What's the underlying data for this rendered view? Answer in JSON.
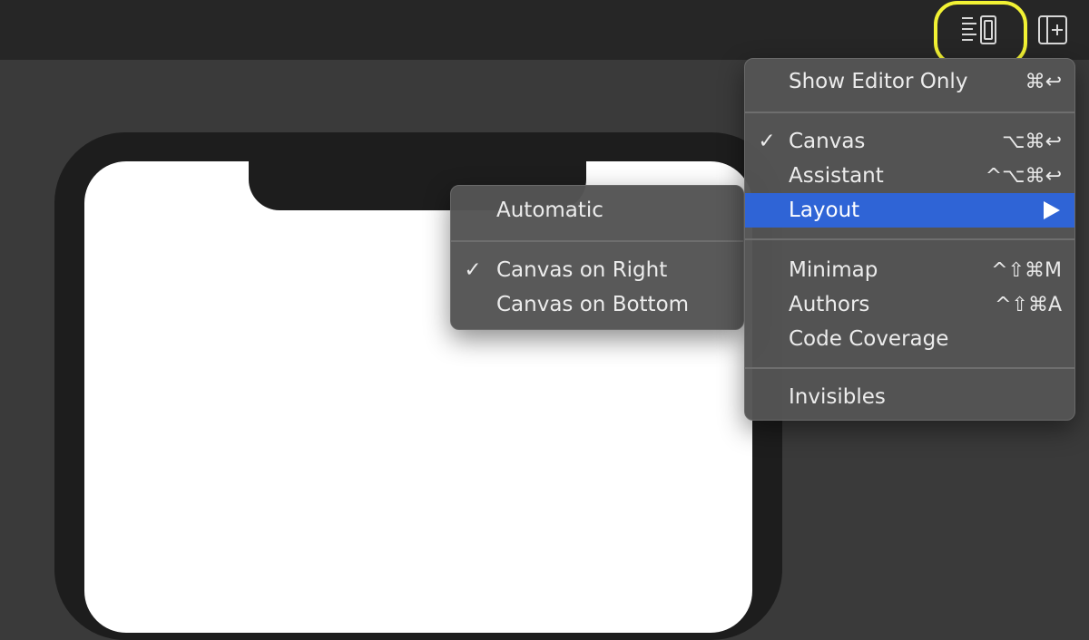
{
  "toolbar": {
    "editor_options_icon": "editor-options-icon",
    "library_icon": "add-library-icon",
    "highlight_color": "#f2f234"
  },
  "editor_menu": {
    "items": [
      {
        "label": "Show Editor Only",
        "shortcut": "⌘↩",
        "checked": false
      },
      {
        "label": "Canvas",
        "shortcut": "⌥⌘↩",
        "checked": true,
        "check_mark": "✓"
      },
      {
        "label": "Assistant",
        "shortcut": "^⌥⌘↩",
        "checked": false
      },
      {
        "label": "Layout",
        "has_submenu": true,
        "selected": true
      },
      {
        "label": "Minimap",
        "shortcut": "^⇧⌘M",
        "checked": false
      },
      {
        "label": "Authors",
        "shortcut": "^⇧⌘A",
        "checked": false
      },
      {
        "label": "Code Coverage",
        "checked": false
      },
      {
        "label": "Invisibles",
        "checked": false
      }
    ],
    "selection_color": "#2f64d6"
  },
  "layout_submenu": {
    "items": [
      {
        "label": "Automatic",
        "checked": false
      },
      {
        "label": "Canvas on Right",
        "checked": true,
        "check_mark": "✓"
      },
      {
        "label": "Canvas on Bottom",
        "checked": false
      }
    ]
  }
}
